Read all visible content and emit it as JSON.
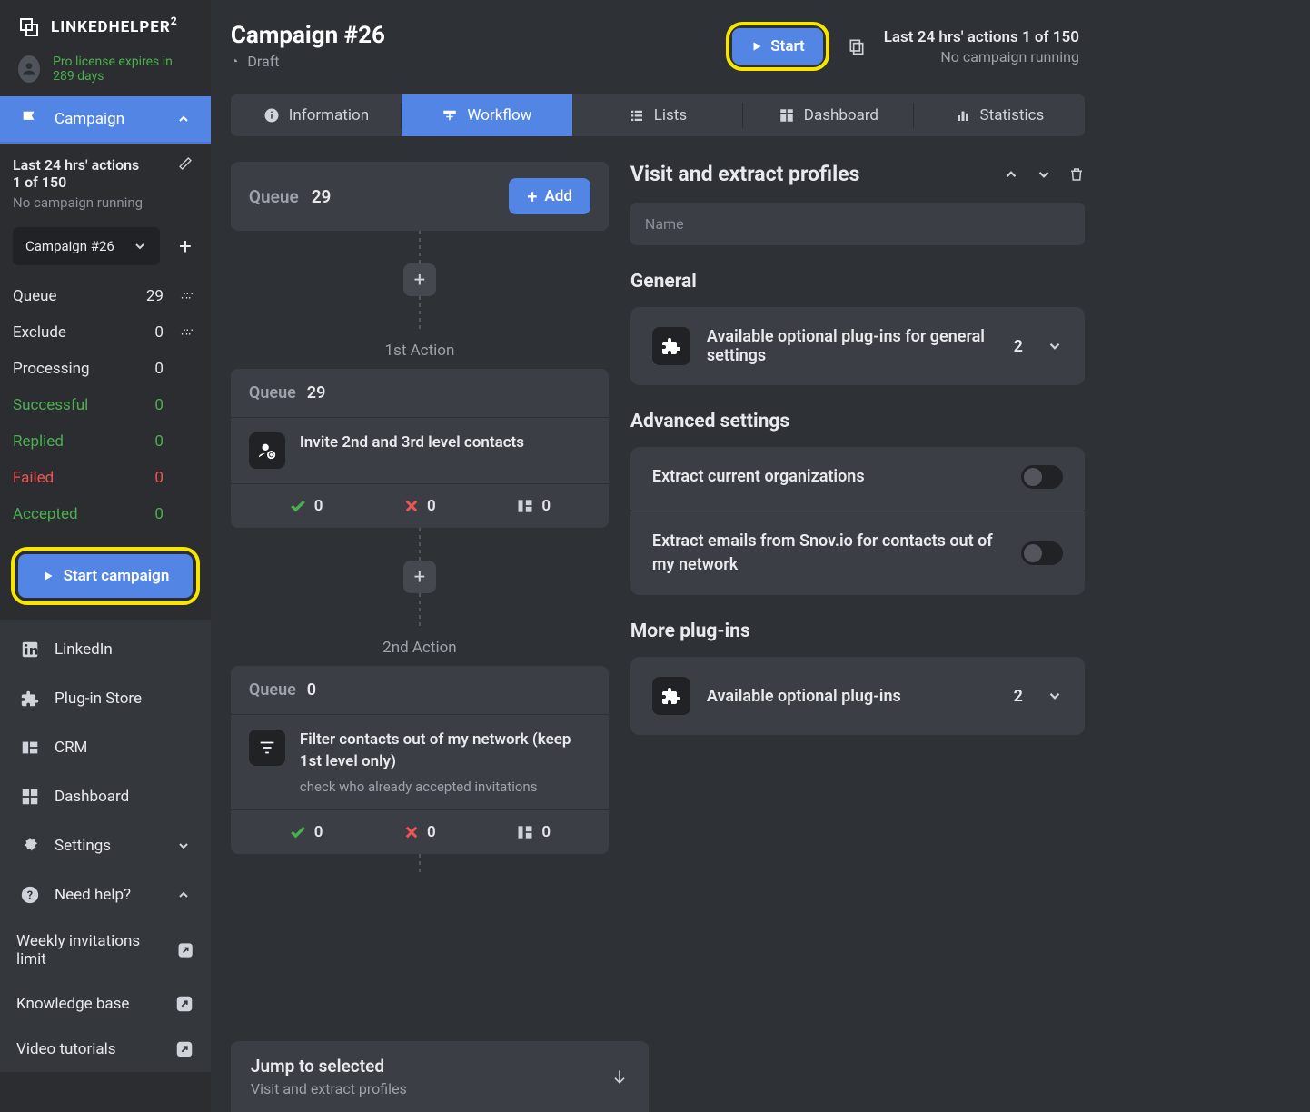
{
  "brand": {
    "name": "LINKEDHELPER",
    "sup": "2"
  },
  "license": "Pro license expires in 289 days",
  "sidebar": {
    "campaign": "Campaign",
    "last24_l1": "Last 24 hrs' actions",
    "last24_l2": "1 of 150",
    "nostat": "No campaign running",
    "selected_campaign": "Campaign #26",
    "stats": [
      {
        "label": "Queue",
        "val": "29",
        "extra": true,
        "cls": ""
      },
      {
        "label": "Exclude",
        "val": "0",
        "extra": true,
        "cls": ""
      },
      {
        "label": "Processing",
        "val": "0",
        "extra": false,
        "cls": ""
      },
      {
        "label": "Successful",
        "val": "0",
        "extra": false,
        "cls": "green"
      },
      {
        "label": "Replied",
        "val": "0",
        "extra": false,
        "cls": "green"
      },
      {
        "label": "Failed",
        "val": "0",
        "extra": false,
        "cls": "red"
      },
      {
        "label": "Accepted",
        "val": "0",
        "extra": false,
        "cls": "green"
      }
    ],
    "start_btn": "Start campaign",
    "nav2": [
      {
        "label": "LinkedIn",
        "icon": "linkedin"
      },
      {
        "label": "Plug-in Store",
        "icon": "puzzle"
      },
      {
        "label": "CRM",
        "icon": "crm"
      },
      {
        "label": "Dashboard",
        "icon": "dashboard"
      },
      {
        "label": "Settings",
        "icon": "gear",
        "chev": true
      },
      {
        "label": "Need help?",
        "icon": "help",
        "chev_up": true
      }
    ],
    "help_items": [
      {
        "label": "Weekly invitations limit"
      },
      {
        "label": "Knowledge base"
      },
      {
        "label": "Video tutorials"
      }
    ]
  },
  "header": {
    "title": "Campaign #26",
    "status": "Draft",
    "start": "Start",
    "r1": "Last 24 hrs' actions 1 of 150",
    "r2": "No campaign running"
  },
  "tabs": [
    {
      "label": "Information"
    },
    {
      "label": "Workflow",
      "active": true
    },
    {
      "label": "Lists"
    },
    {
      "label": "Dashboard"
    },
    {
      "label": "Statistics"
    }
  ],
  "flow": {
    "queue_label": "Queue",
    "queue_val": "29",
    "add": "Add",
    "a1_label": "1st Action",
    "a1_queue": "29",
    "a1_title": "Invite 2nd and 3rd level contacts",
    "a1_c1": "0",
    "a1_c2": "0",
    "a1_c3": "0",
    "a2_label": "2nd Action",
    "a2_queue": "0",
    "a2_title": "Filter contacts out of my network (keep 1st level only)",
    "a2_sub": "check who already accepted invitations",
    "a2_c1": "0",
    "a2_c2": "0",
    "a2_c3": "0",
    "jump_t": "Jump to selected",
    "jump_s": "Visit and extract profiles"
  },
  "details": {
    "title": "Visit and extract profiles",
    "name_ph": "Name",
    "sec_general": "General",
    "plugin1_txt": "Available optional plug-ins for general settings",
    "plugin1_cnt": "2",
    "sec_adv": "Advanced settings",
    "t1": "Extract current organizations",
    "t2": "Extract emails from Snov.io for contacts out of my network",
    "sec_more": "More plug-ins",
    "plugin2_txt": "Available optional plug-ins",
    "plugin2_cnt": "2"
  }
}
